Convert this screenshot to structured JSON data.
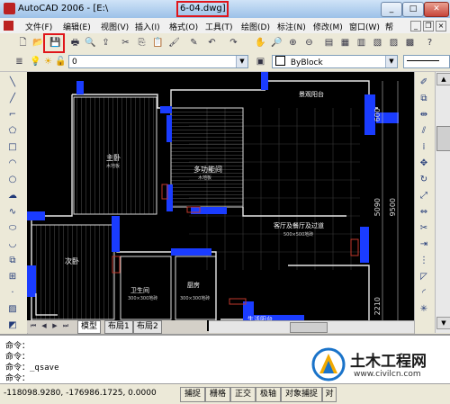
{
  "window": {
    "title": "AutoCAD 2006 - [E:\\",
    "title_file": "6-04.dwg]",
    "min": "_",
    "max": "□",
    "close": "✕"
  },
  "menu": [
    "文件(F)",
    "编辑(E)",
    "视图(V)",
    "插入(I)",
    "格式(O)",
    "工具(T)",
    "绘图(D)",
    "标注(N)",
    "修改(M)",
    "窗口(W)",
    "帮"
  ],
  "layer": {
    "value": "0"
  },
  "linetype": {
    "value": "ByBlock"
  },
  "drawing": {
    "rooms": [
      "主卧",
      "多功能间",
      "客厅及餐厅及过道",
      "次卧",
      "卫生间",
      "厨房",
      "景观阳台",
      "生活阳台"
    ],
    "dims": [
      "600",
      "5090",
      "9500",
      "2210"
    ],
    "subtexts": [
      "木地板",
      "木地板",
      "500×500地砖",
      "300×300地砖",
      "300×300地砖"
    ]
  },
  "tabs": [
    "模型",
    "布局1",
    "布局2"
  ],
  "command": {
    "lines": [
      "命令：",
      "命令：",
      "命令：_qsave",
      "命令："
    ]
  },
  "status": {
    "coords": "-118098.9280, -176986.1725, 0.0000",
    "buttons": [
      "捕捉",
      "栅格",
      "正交",
      "极轴",
      "对象捕捉",
      "对"
    ]
  },
  "watermark": {
    "title": "土木工程网",
    "url": "www.civilcn.com"
  },
  "colors": {
    "accent_red": "#e0161b",
    "wall_blue": "#1a3cff"
  }
}
